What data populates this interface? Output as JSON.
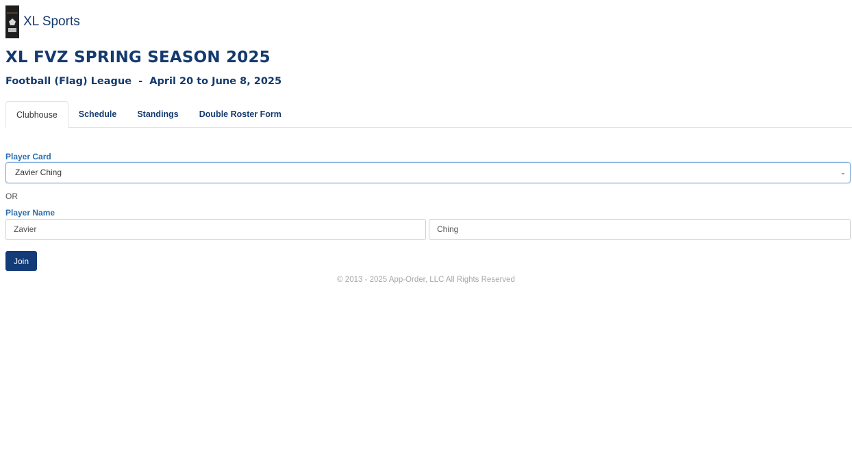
{
  "header": {
    "brand_name": "XL Sports",
    "title": "XL FVZ SPRING SEASON 2025",
    "subtitle": "Football (Flag) League  -  April 20 to June 8, 2025"
  },
  "tabs": [
    {
      "label": "Clubhouse",
      "active": true
    },
    {
      "label": "Schedule",
      "active": false
    },
    {
      "label": "Standings",
      "active": false
    },
    {
      "label": "Double Roster Form",
      "active": false
    }
  ],
  "form": {
    "player_card_label": "Player Card",
    "player_card_value": "Zavier Ching",
    "or_text": "OR",
    "player_name_label": "Player Name",
    "first_name_value": "Zavier",
    "last_name_value": "Ching",
    "join_label": "Join"
  },
  "footer": {
    "copyright": "© 2013 - 2025 App-Order, LLC All Rights Reserved"
  },
  "colors": {
    "brand": "#143a6e",
    "label": "#2a6fb0",
    "button": "#123b78"
  }
}
